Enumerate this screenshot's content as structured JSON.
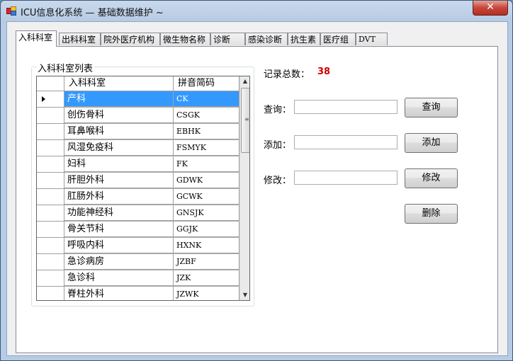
{
  "window": {
    "title": "ICU信息化系统 — 基础数据维护  ~",
    "close_glyph": "✕"
  },
  "tabs": [
    {
      "label": "入科科室",
      "active": true
    },
    {
      "label": "出科科室",
      "active": false
    },
    {
      "label": "院外医疗机构",
      "active": false
    },
    {
      "label": "微生物名称",
      "active": false
    },
    {
      "label": "诊断",
      "active": false
    },
    {
      "label": "感染诊断",
      "active": false
    },
    {
      "label": "抗生素",
      "active": false
    },
    {
      "label": "医疗组",
      "active": false
    },
    {
      "label": "DVT",
      "active": false
    }
  ],
  "group": {
    "title": "入科科室列表"
  },
  "grid": {
    "columns": [
      "入科科室",
      "拼音简码"
    ],
    "rows": [
      {
        "name": "产科",
        "code": "CK",
        "selected": true
      },
      {
        "name": "创伤骨科",
        "code": "CSGK"
      },
      {
        "name": "耳鼻喉科",
        "code": "EBHK"
      },
      {
        "name": "风湿免疫科",
        "code": "FSMYK"
      },
      {
        "name": "妇科",
        "code": "FK"
      },
      {
        "name": "肝胆外科",
        "code": "GDWK"
      },
      {
        "name": "肛肠外科",
        "code": "GCWK"
      },
      {
        "name": "功能神经科",
        "code": "GNSJK"
      },
      {
        "name": "骨关节科",
        "code": "GGJK"
      },
      {
        "name": "呼吸内科",
        "code": "HXNK"
      },
      {
        "name": "急诊病房",
        "code": "JZBF"
      },
      {
        "name": "急诊科",
        "code": "JZK"
      },
      {
        "name": "脊柱外科",
        "code": "JZWK"
      }
    ]
  },
  "stats": {
    "total_label": "记录总数：",
    "total_value": "38"
  },
  "form": {
    "query_label": "查询：",
    "query_value": "",
    "query_button": "查询",
    "add_label": "添加：",
    "add_value": "",
    "add_button": "添加",
    "edit_label": "修改：",
    "edit_value": "",
    "edit_button": "修改",
    "delete_button": "删除"
  },
  "icons": {
    "row_selector": "row-selector-arrow-icon",
    "scroll_up": "scroll-up-arrow-icon",
    "scroll_down": "scroll-down-arrow-icon",
    "app": "app-icon"
  }
}
